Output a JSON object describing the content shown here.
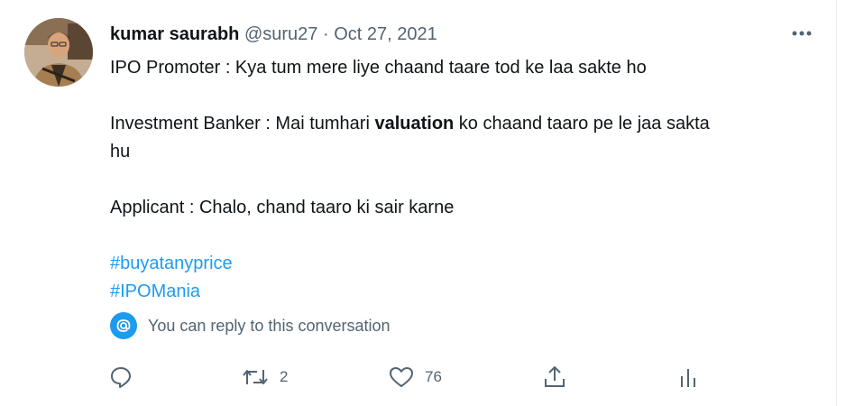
{
  "tweet": {
    "author_name": "kumar saurabh",
    "handle": "@suru27",
    "separator": "·",
    "date": "Oct 27, 2021",
    "more_icon": "more-horizontal-icon",
    "body": {
      "line1": "IPO Promoter : Kya tum mere liye chaand taare tod ke laa sakte ho",
      "line2_prefix": "Investment Banker : Mai tumhari ",
      "line2_bold": "valuation",
      "line2_suffix": " ko chaand taaro pe le jaa sakta",
      "line3": "hu",
      "line4": "Applicant : Chalo, chand taaro ki sair karne",
      "hashtags": [
        "#buyatanyprice",
        "#IPOMania"
      ]
    },
    "reply_notice": "You can reply to this conversation",
    "actions": {
      "reply_icon": "reply-icon",
      "retweet_icon": "retweet-icon",
      "retweet_count": "2",
      "like_icon": "heart-icon",
      "like_count": "76",
      "share_icon": "share-icon",
      "analytics_icon": "analytics-icon"
    },
    "colors": {
      "link": "#1d9bf0",
      "secondary_text": "#536471",
      "primary_text": "#0f1419"
    }
  }
}
